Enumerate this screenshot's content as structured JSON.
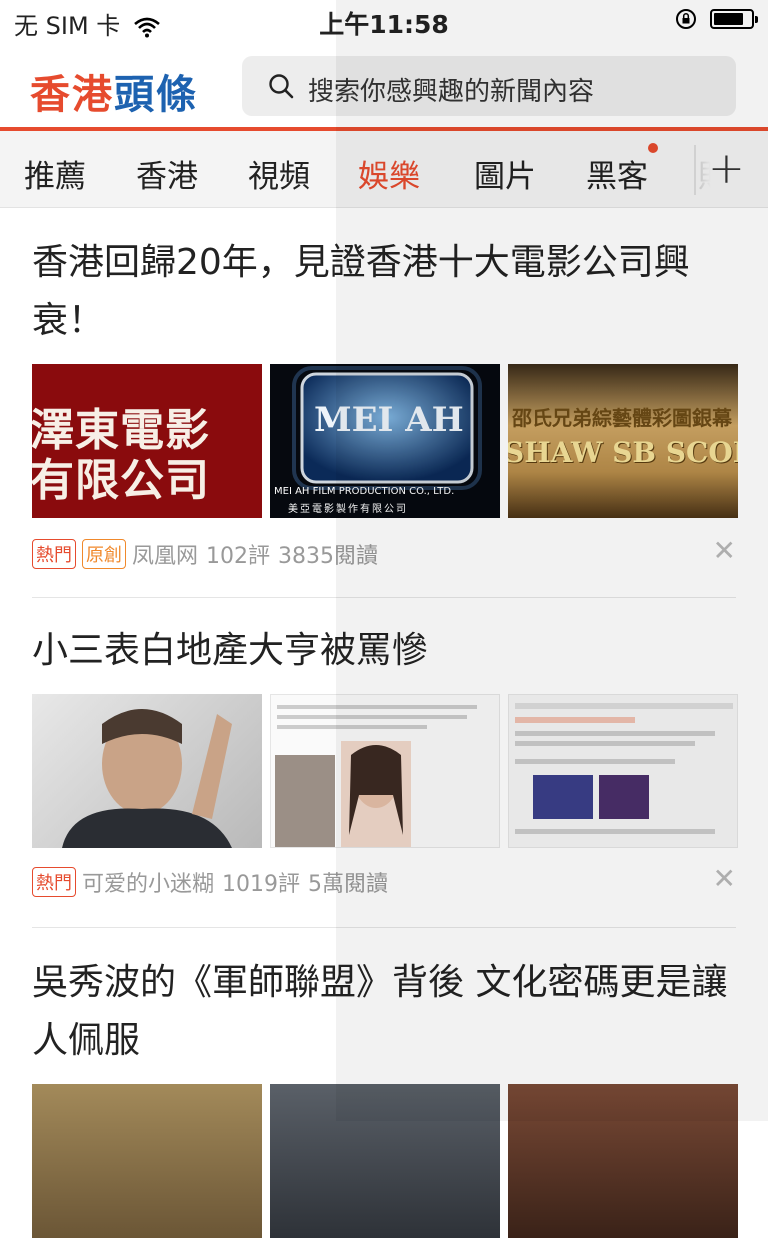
{
  "status_bar": {
    "carrier": "无 SIM 卡",
    "time": "上午11:58",
    "battery_level": 0.8
  },
  "header": {
    "logo_part1": "香港",
    "logo_part2": "頭條",
    "search_placeholder": "搜索你感興趣的新聞內容"
  },
  "colors": {
    "accent": "#e64b2e",
    "brand_blue": "#1d62b0",
    "tag_orange": "#f0892c"
  },
  "tabs": [
    {
      "label": "推薦",
      "active": false
    },
    {
      "label": "香港",
      "active": false
    },
    {
      "label": "視頻",
      "active": false
    },
    {
      "label": "娛樂",
      "active": true
    },
    {
      "label": "圖片",
      "active": false
    },
    {
      "label": "黑客",
      "active": false,
      "badge_dot": true
    },
    {
      "label": "財",
      "active": false
    }
  ],
  "add_tab_icon": "plus-icon",
  "articles": [
    {
      "title": "香港回歸20年，見證香港十大電影公司興衰！",
      "images": [
        {
          "text_line1": "澤東電影",
          "text_line2": "有限公司"
        },
        {
          "logo": "MEI AH",
          "caption": "MEI AH FILM PRODUCTION CO., LTD.",
          "caption2": "美亞電影製作有限公司"
        },
        {
          "banner": "邵氏兄弟綜藝體彩圖銀幕",
          "logo": "SHAW SB SCOPE"
        }
      ],
      "tags": [
        "熱門",
        "原創"
      ],
      "source": "凤凰网",
      "comments": "102評",
      "reads": "3835閱讀"
    },
    {
      "title": "小三表白地產大亨被罵慘",
      "tags": [
        "熱門"
      ],
      "source": "可爱的小迷糊",
      "comments": "1019評",
      "reads": "5萬閱讀"
    },
    {
      "title": "吳秀波的《軍師聯盟》背後 文化密碼更是讓人佩服"
    }
  ]
}
